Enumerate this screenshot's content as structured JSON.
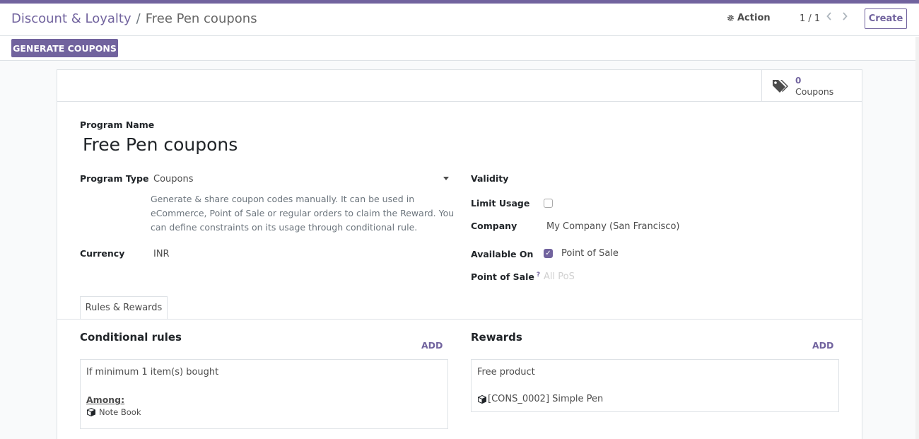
{
  "breadcrumb": {
    "parent": "Discount & Loyalty",
    "separator": "/",
    "current": "Free Pen coupons"
  },
  "control": {
    "action_label": "Action",
    "pager": "1 / 1",
    "create_label": "Create",
    "generate_label": "GENERATE COUPONS"
  },
  "smart_button": {
    "count": "0",
    "label": "Coupons"
  },
  "form": {
    "program_name_label": "Program Name",
    "program_name": "Free Pen coupons",
    "program_type_label": "Program Type",
    "program_type": "Coupons",
    "program_type_help": "Generate & share coupon codes manually. It can be used in eCommerce, Point of Sale or regular orders to claim the Reward. You can define constraints on its usage through conditional rule.",
    "currency_label": "Currency",
    "currency": "INR",
    "validity_label": "Validity",
    "limit_usage_label": "Limit Usage",
    "limit_usage_checked": false,
    "company_label": "Company",
    "company": "My Company (San Francisco)",
    "available_on_label": "Available On",
    "available_on_pos_checked": true,
    "available_on_pos": "Point of Sale",
    "point_of_sale_label": "Point of Sale",
    "point_of_sale_help": "?",
    "point_of_sale_placeholder": "All PoS"
  },
  "tabs": [
    {
      "label": "Rules & Rewards",
      "active": true
    }
  ],
  "rules": {
    "title": "Conditional rules",
    "add_label": "ADD",
    "card": {
      "condition": "If minimum 1 item(s) bought",
      "among_label": "Among:",
      "product": "Note Book"
    }
  },
  "rewards": {
    "title": "Rewards",
    "add_label": "ADD",
    "card": {
      "type": "Free product",
      "product": "[CONS_0002] Simple Pen"
    }
  },
  "colors": {
    "brand": "#71639e",
    "border": "#dee2e6"
  }
}
